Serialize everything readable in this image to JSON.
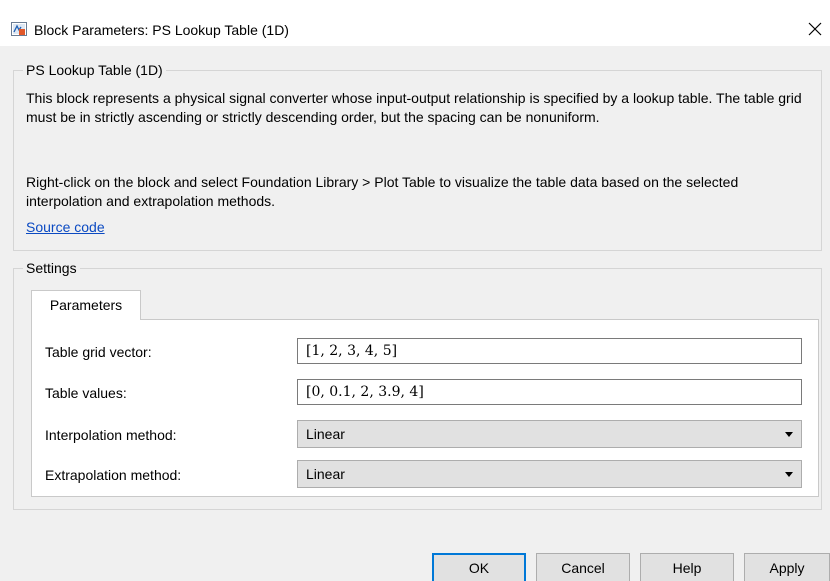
{
  "window": {
    "title": "Block Parameters: PS Lookup Table (1D)",
    "close_glyph": "✕",
    "app_icon": "simulink-block-icon"
  },
  "description": {
    "group_title": "PS Lookup Table (1D)",
    "paragraph1": "This block represents a physical signal converter whose input-output relationship is specified by a lookup table. The table grid must be in strictly ascending or strictly descending order, but the spacing can be nonuniform.",
    "paragraph2": "Right-click on the block and select Foundation Library > Plot Table to visualize the table data based on the selected interpolation and extrapolation methods.",
    "link": "Source code"
  },
  "settings": {
    "group_title": "Settings",
    "tabs": [
      {
        "label": "Parameters",
        "active": true
      }
    ],
    "parameters": [
      {
        "label": "Table grid vector:",
        "type": "text",
        "value": "[1, 2, 3, 4, 5]"
      },
      {
        "label": "Table values:",
        "type": "text",
        "value": "[0, 0.1, 2, 3.9, 4]"
      },
      {
        "label": "Interpolation method:",
        "type": "select",
        "value": "Linear"
      },
      {
        "label": "Extrapolation method:",
        "type": "select",
        "value": "Linear"
      }
    ]
  },
  "buttons": {
    "ok": "OK",
    "cancel": "Cancel",
    "help": "Help",
    "apply": "Apply"
  },
  "colors": {
    "link": "#0b4ac2",
    "default_button_border": "#0078d7",
    "background": "#f0f0f0"
  }
}
